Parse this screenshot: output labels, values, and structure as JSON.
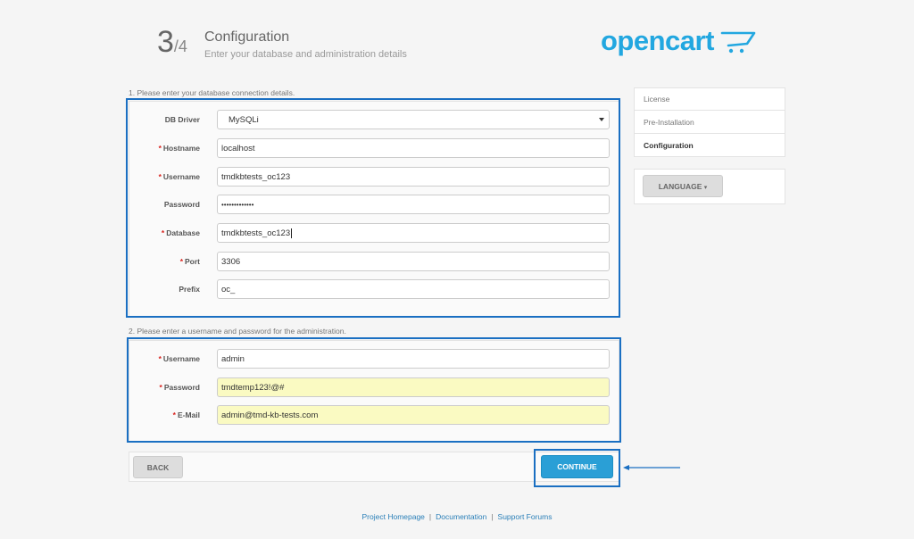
{
  "header": {
    "step_current": "3",
    "step_total": "/4",
    "title": "Configuration",
    "subtitle": "Enter your database and administration details"
  },
  "logo": {
    "text": "opencart",
    "color": "#22a7e0"
  },
  "db_section": {
    "label": "1. Please enter your database connection details.",
    "fields": [
      {
        "label": "DB Driver",
        "required": false,
        "value": "MySQLi",
        "type": "select"
      },
      {
        "label": "Hostname",
        "required": true,
        "value": "localhost"
      },
      {
        "label": "Username",
        "required": true,
        "value": "tmdkbtests_oc123"
      },
      {
        "label": "Password",
        "required": false,
        "value": "•••••••••••••"
      },
      {
        "label": "Database",
        "required": true,
        "value": "tmdkbtests_oc123"
      },
      {
        "label": "Port",
        "required": true,
        "value": "3306"
      },
      {
        "label": "Prefix",
        "required": false,
        "value": "oc_"
      }
    ]
  },
  "admin_section": {
    "label": "2. Please enter a username and password for the administration.",
    "fields": [
      {
        "label": "Username",
        "required": true,
        "value": "admin"
      },
      {
        "label": "Password",
        "required": true,
        "value": "tmdtemp123!@#"
      },
      {
        "label": "E-Mail",
        "required": true,
        "value": "admin@tmd-kb-tests.com"
      }
    ]
  },
  "buttons": {
    "back": "BACK",
    "continue": "CONTINUE"
  },
  "sidebar": {
    "steps": [
      {
        "label": "License",
        "active": false
      },
      {
        "label": "Pre-Installation",
        "active": false
      },
      {
        "label": "Configuration",
        "active": true
      }
    ],
    "language_button": "LANGUAGE"
  },
  "footer": {
    "links": [
      "Project Homepage",
      "Documentation",
      "Support Forums"
    ],
    "separator": "|"
  },
  "colors": {
    "highlight_border": "#1a6fc2",
    "required_star": "#d9231e",
    "continue_button": "#2a9fd6",
    "autofill_yellow": "#fafac2"
  }
}
